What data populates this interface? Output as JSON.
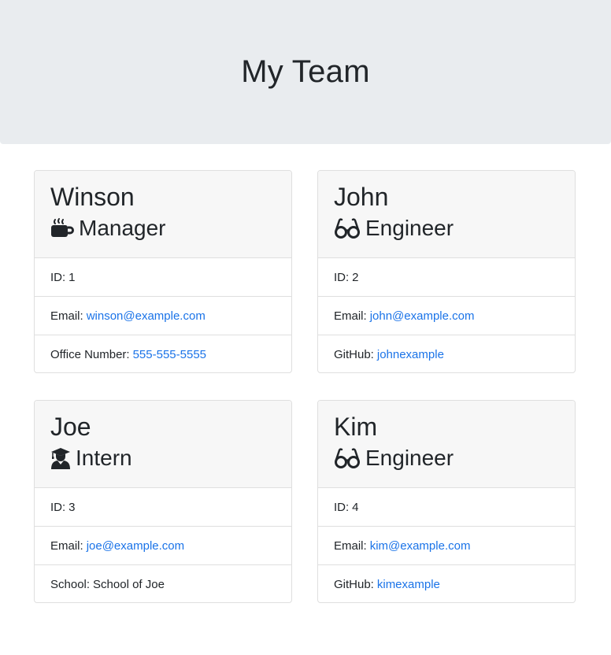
{
  "header": {
    "title": "My Team"
  },
  "cards": [
    {
      "name": "Winson",
      "role": "Manager",
      "icon": "coffee-icon",
      "id_label": "ID:",
      "id_value": "1",
      "email_label": "Email:",
      "email_value": "winson@example.com",
      "extra_label": "Office Number:",
      "extra_value": "555-555-5555"
    },
    {
      "name": "John",
      "role": "Engineer",
      "icon": "glasses-icon",
      "id_label": "ID:",
      "id_value": "2",
      "email_label": "Email:",
      "email_value": "john@example.com",
      "extra_label": "GitHub:",
      "extra_value": "johnexample"
    },
    {
      "name": "Joe",
      "role": "Intern",
      "icon": "graduate-icon",
      "id_label": "ID:",
      "id_value": "3",
      "email_label": "Email:",
      "email_value": "joe@example.com",
      "extra_label": "School:",
      "extra_value": "School of Joe"
    },
    {
      "name": "Kim",
      "role": "Engineer",
      "icon": "glasses-icon",
      "id_label": "ID:",
      "id_value": "4",
      "email_label": "Email:",
      "email_value": "kim@example.com",
      "extra_label": "GitHub:",
      "extra_value": "kimexample"
    }
  ],
  "colors": {
    "header_bg": "#e9ecef",
    "card_header_bg": "#f7f7f7",
    "link": "#1a73e8",
    "text": "#212529"
  }
}
